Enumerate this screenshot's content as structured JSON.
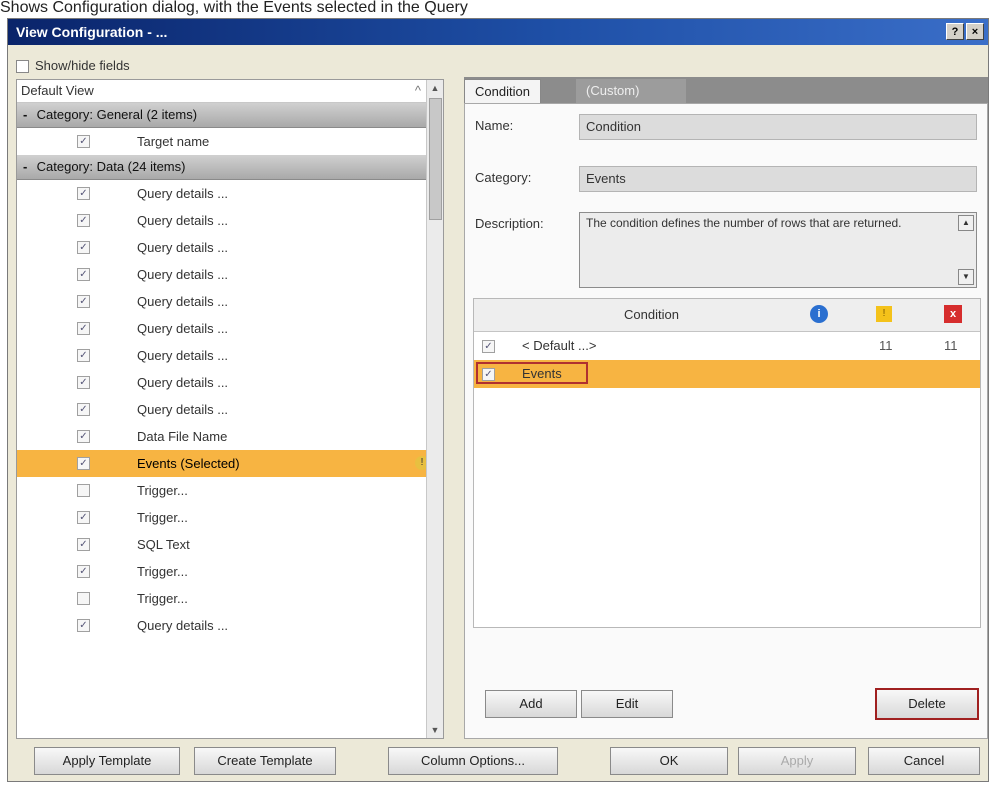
{
  "caption": "Shows Configuration dialog, with the Events selected in the Query",
  "window": {
    "title": "View Configuration - ..."
  },
  "left": {
    "header_label": "Show/hide fields",
    "tree_header": "Default View",
    "sort_label": "^",
    "categories": [
      {
        "label": "Category: General (2 items)",
        "toggle": "-"
      },
      {
        "label": "Category: Data (24 items)",
        "toggle": "-"
      }
    ],
    "group1_items": [
      {
        "label": "Target name",
        "checked": "✓"
      }
    ],
    "group2_items": [
      {
        "label": "Query details ...",
        "checked": "✓"
      },
      {
        "label": "Query details ...",
        "checked": "✓"
      },
      {
        "label": "Query details ...",
        "checked": "✓"
      },
      {
        "label": "Query details ...",
        "checked": "✓"
      },
      {
        "label": "Query details ...",
        "checked": "✓"
      },
      {
        "label": "Query details ...",
        "checked": "✓"
      },
      {
        "label": "Query details ...",
        "checked": "✓"
      },
      {
        "label": "Query details ...",
        "checked": "✓"
      },
      {
        "label": "Query details ...",
        "checked": "✓"
      },
      {
        "label": "Data File Name",
        "checked": "✓"
      },
      {
        "label": "Events (Selected)",
        "checked": "✓",
        "selected": true,
        "badge": "!"
      },
      {
        "label": "Trigger...",
        "checked": ""
      },
      {
        "label": "Trigger...",
        "checked": "✓"
      },
      {
        "label": "SQL Text",
        "checked": "✓"
      },
      {
        "label": "Trigger...",
        "checked": "✓"
      },
      {
        "label": "Trigger...",
        "checked": ""
      },
      {
        "label": "Query details ...",
        "checked": "✓"
      }
    ]
  },
  "right": {
    "tabs": {
      "active": "Condition",
      "inactive": "(Custom)"
    },
    "name_label": "Name:",
    "name_value": "Condition",
    "category_label": "Category:",
    "category_value": "Events",
    "description_label": "Description:",
    "description_value": "The condition defines the number of rows that are returned.",
    "grid": {
      "column": "Condition",
      "icons": {
        "info": "i",
        "warn": "!",
        "error": "x"
      },
      "rows": [
        {
          "name": "< Default ...>",
          "checked": "✓",
          "v1": "11",
          "v2": "11"
        },
        {
          "name": "Events",
          "checked": "✓",
          "v1": "",
          "v2": "",
          "selected": true
        }
      ]
    },
    "buttons": {
      "add": "Add",
      "edit": "Edit",
      "delete": "Delete"
    }
  },
  "bottom_buttons": {
    "apply_template": "Apply Template",
    "create_template": "Create Template",
    "column_options": "Column Options...",
    "ok": "OK",
    "apply": "Apply",
    "cancel": "Cancel"
  },
  "colors": {
    "selection": "#f7b442",
    "accent": "#0a246a"
  }
}
